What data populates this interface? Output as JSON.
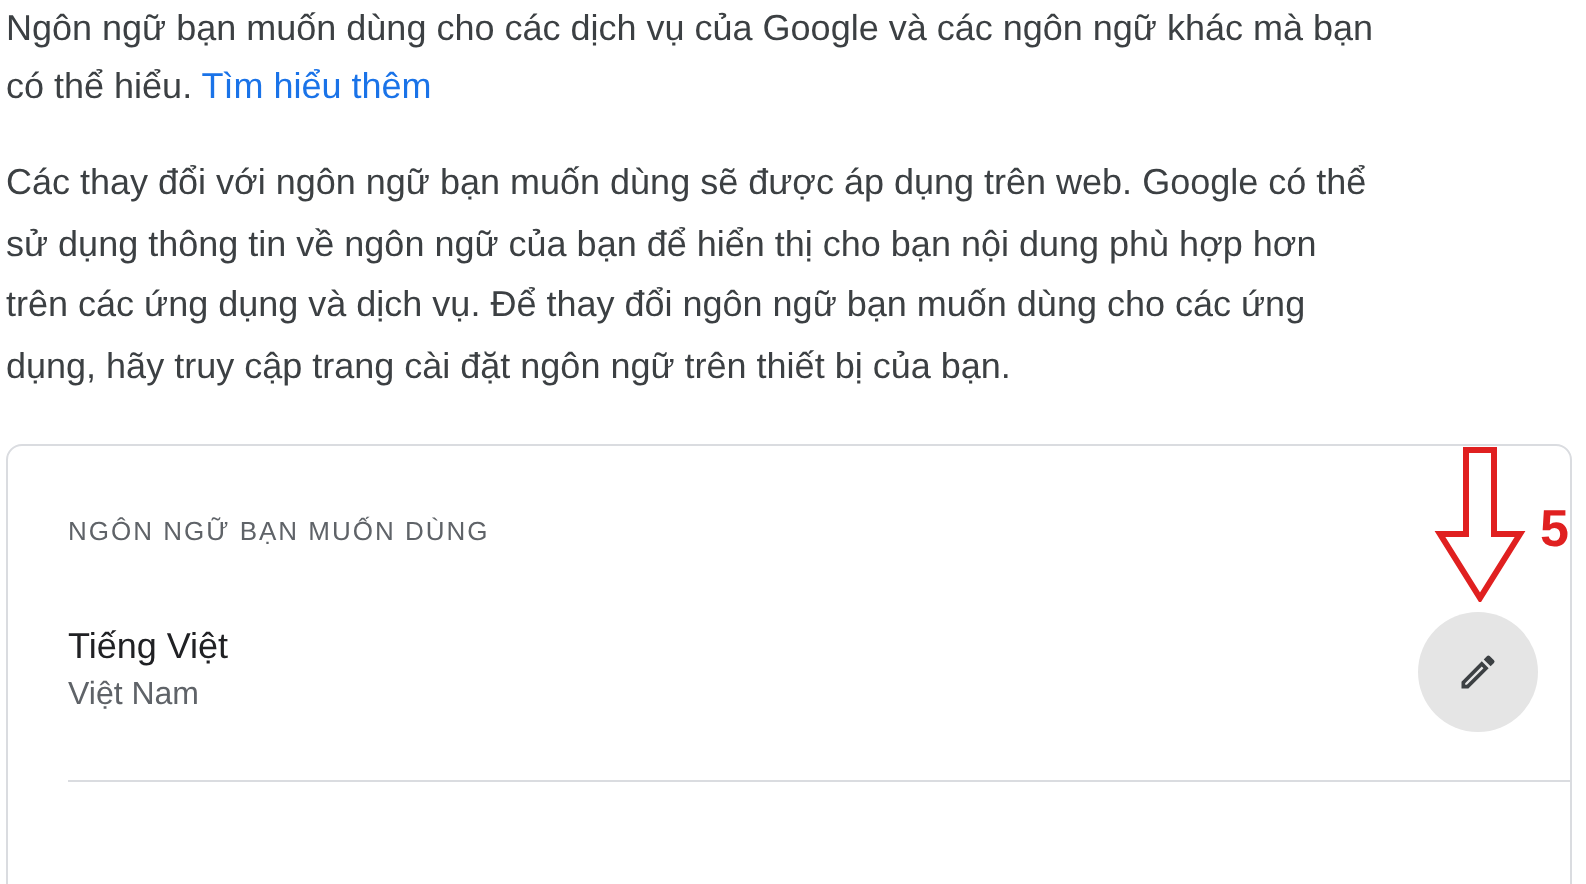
{
  "intro": {
    "text": "Ngôn ngữ bạn muốn dùng cho các dịch vụ của Google và các ngôn ngữ khác mà bạn có thể hiểu.",
    "link": "Tìm hiểu thêm"
  },
  "note": "Các thay đổi với ngôn ngữ bạn muốn dùng sẽ được áp dụng trên web. Google có thể sử dụng thông tin về ngôn ngữ của bạn để hiển thị cho bạn nội dung phù hợp hơn trên các ứng dụng và dịch vụ. Để thay đổi ngôn ngữ bạn muốn dùng cho các ứng dụng, hãy truy cập trang cài đặt ngôn ngữ trên thiết bị của bạn.",
  "card": {
    "heading": "NGÔN NGỮ BẠN MUỐN DÙNG",
    "languages": [
      {
        "name": "Tiếng Việt",
        "region": "Việt Nam"
      }
    ]
  },
  "annotation": {
    "label": "5"
  }
}
